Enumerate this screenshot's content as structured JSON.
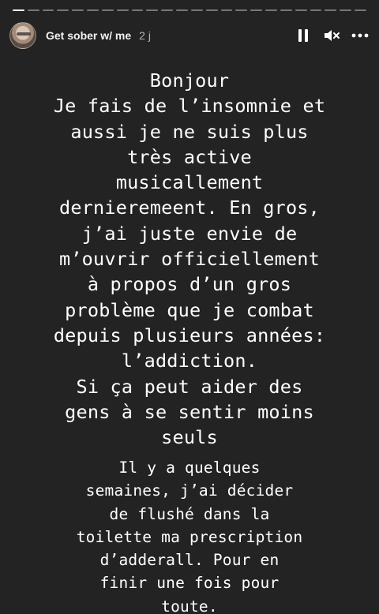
{
  "theme": {
    "background": "#232323",
    "text": "#ffffff"
  },
  "progress": {
    "segments": 24,
    "active_index": 0
  },
  "header": {
    "username": "Get sober w/ me",
    "time": "2 j",
    "pause_icon": "pause-icon",
    "mute_icon": "speaker-muted-icon",
    "more_icon": "more-horizontal-icon"
  },
  "story": {
    "block1_lines": [
      "Bonjour",
      "Je fais de l’insomnie et",
      "aussi je ne suis plus",
      "très active",
      "musicallement",
      "dernieremeent. En gros,",
      "j’ai juste envie de",
      "m’ouvrir officiellement",
      "à propos d’un gros",
      "problème que je combat",
      "depuis plusieurs années:",
      "l’addiction.",
      "Si ça peut aider des",
      "gens à se sentir moins",
      "seuls"
    ],
    "block2_lines": [
      "Il y a quelques",
      "semaines, j’ai décider",
      "de flushé dans la",
      "toilette ma prescription",
      "d’adderall. Pour en",
      "finir une fois pour",
      "toute."
    ]
  }
}
